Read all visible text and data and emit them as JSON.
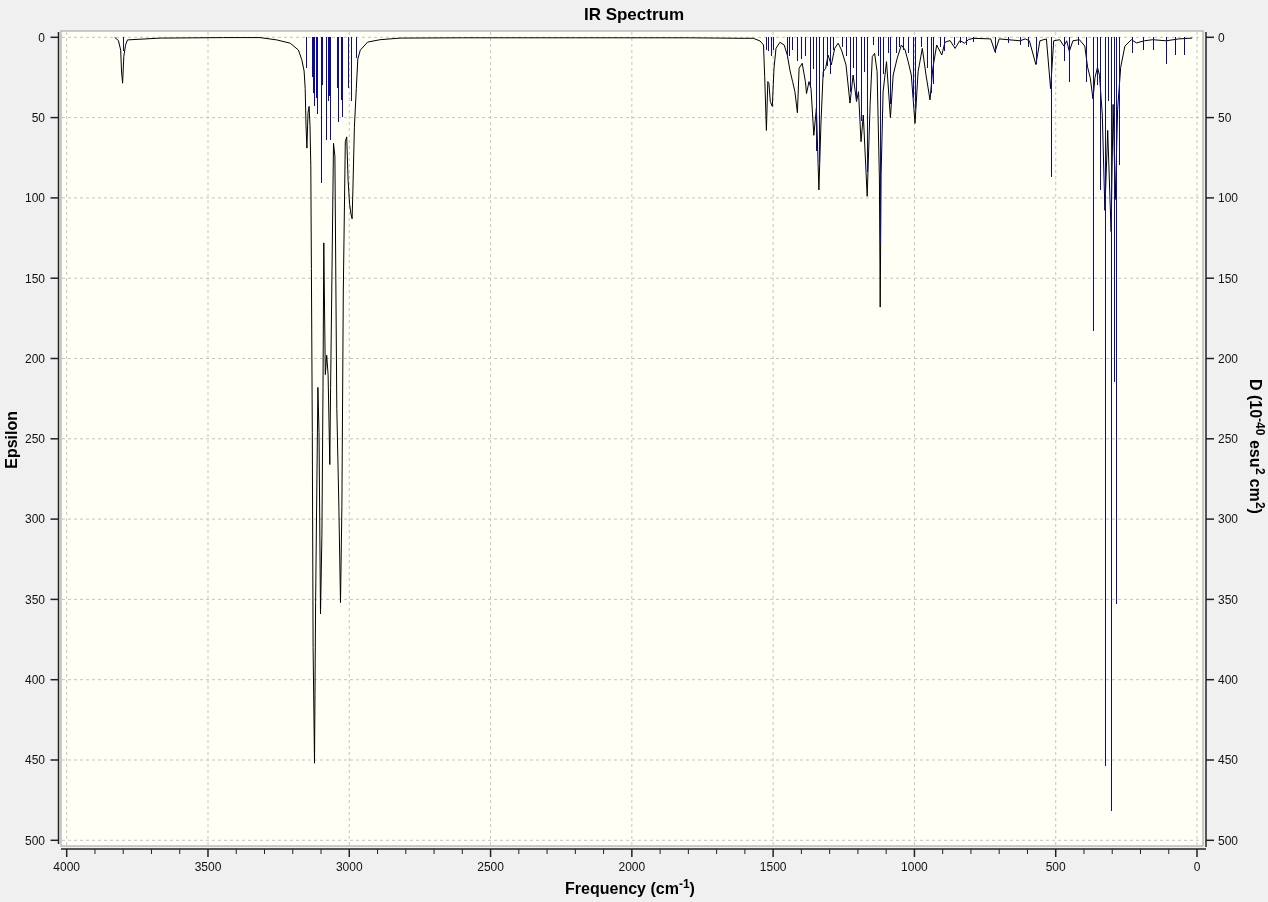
{
  "chart_data": {
    "type": "line",
    "title": "IR Spectrum",
    "xlabel": "Frequency (cm$^{-1}$)",
    "ylabel": "Epsilon",
    "y2label": "D (10$^{-40}$ esu$^{2}$ cm$^{2}$)",
    "xlim": [
      4000,
      0
    ],
    "ylim": [
      500,
      0
    ],
    "y2lim": [
      500,
      0
    ],
    "grid": true,
    "xticks": [
      4000,
      3500,
      3000,
      2500,
      2000,
      1500,
      1000,
      500,
      0
    ],
    "yticks": [
      0,
      50,
      100,
      150,
      200,
      250,
      300,
      350,
      400,
      450,
      500
    ],
    "y2ticks": [
      0,
      50,
      100,
      150,
      200,
      250,
      300,
      350,
      400,
      450,
      500
    ],
    "series": [
      {
        "color": "#000000",
        "x": [
          3830,
          3817,
          3809,
          3806,
          3802,
          3798,
          3792,
          3785,
          3669,
          3445,
          3316,
          3257,
          3209,
          3180,
          3168,
          3160,
          3156,
          3153,
          3150,
          3146,
          3142,
          3139,
          3136,
          3134,
          3131,
          3128,
          3123,
          3119,
          3111,
          3107,
          3102,
          3097,
          3093,
          3090,
          3085,
          3080,
          3075,
          3069,
          3066,
          3061,
          3056,
          3051,
          3044,
          3037,
          3031,
          3026,
          3021,
          3014,
          3009,
          3004,
          2999,
          2994,
          2990,
          2987,
          2982,
          2975,
          2970,
          2961,
          2935,
          2891,
          2820,
          2600,
          2200,
          1800,
          1617,
          1570,
          1546,
          1534,
          1530,
          1524,
          1519,
          1515,
          1510,
          1503,
          1497,
          1490,
          1476,
          1461,
          1450,
          1440,
          1431,
          1423,
          1414,
          1408,
          1397,
          1386,
          1382,
          1373,
          1366,
          1356,
          1347,
          1338,
          1331,
          1323,
          1314,
          1306,
          1294,
          1282,
          1270,
          1258,
          1242,
          1228,
          1217,
          1205,
          1198,
          1189,
          1181,
          1167,
          1157,
          1149,
          1141,
          1132,
          1124,
          1121,
          1118,
          1111,
          1099,
          1085,
          1075,
          1061,
          1046,
          1033,
          1022,
          1011,
          998,
          987,
          972,
          959,
          945,
          935,
          921,
          903,
          892,
          874,
          856,
          839,
          823,
          809,
          792,
          730,
          715,
          700,
          626,
          608,
          593,
          570,
          556,
          533,
          518,
          507,
          486,
          471,
          461,
          452,
          439,
          416,
          397,
          387,
          378,
          368,
          361,
          352,
          345,
          335,
          326,
          316,
          304,
          297,
          289,
          281,
          270,
          255,
          232,
          214,
          186,
          157,
          109,
          64,
          17
        ],
        "values": [
          0,
          2,
          8,
          21,
          28.6,
          12,
          4.9,
          1.6,
          0.5,
          0.2,
          0.2,
          1.6,
          3.7,
          7.9,
          14,
          21,
          32,
          55,
          69,
          47,
          43,
          55,
          80,
          144,
          246,
          380,
          452,
          352,
          218,
          246,
          359,
          310,
          218,
          128,
          210,
          198,
          210,
          266,
          218,
          145,
          66,
          74,
          231,
          290,
          352,
          292,
          158,
          65,
          62,
          89,
          104,
          110,
          113,
          95,
          56,
          32,
          13.5,
          8,
          3,
          1.5,
          0.5,
          0.3,
          0.3,
          0.3,
          0.6,
          0.6,
          2.3,
          4.8,
          24.5,
          58,
          27.6,
          28.7,
          40,
          43,
          19.3,
          6.9,
          3.1,
          4.8,
          11,
          21,
          27.6,
          33.8,
          47,
          19.3,
          16.2,
          27.6,
          35,
          27.6,
          31.8,
          61,
          44,
          95,
          54.6,
          21.4,
          19.3,
          11,
          17.2,
          6.9,
          3.7,
          7.9,
          17.2,
          41,
          23.5,
          40,
          33.9,
          65,
          48.4,
          99,
          42,
          12,
          10,
          21.4,
          87.6,
          168,
          85.7,
          33.9,
          15.2,
          50,
          23.5,
          13,
          4.8,
          7.9,
          15.2,
          23.5,
          53.6,
          21.4,
          6.9,
          23.5,
          39,
          19.3,
          4.8,
          11,
          3.1,
          2,
          6.9,
          2,
          3.7,
          1.5,
          0.6,
          1,
          9,
          1,
          2.2,
          1,
          2.2,
          17,
          2.2,
          1,
          32,
          2.2,
          1.5,
          5.5,
          2.2,
          8.8,
          2.2,
          1.5,
          5.5,
          18.7,
          25,
          38.4,
          25,
          18.7,
          23.7,
          48.4,
          107.8,
          58,
          121,
          41.8,
          101,
          45,
          18.7,
          5.5,
          1.5,
          3.5,
          2.2,
          1.5,
          2.2,
          1,
          0.5
        ]
      },
      {
        "type": "bar",
        "color": "#0a0aa0",
        "x": [
          3802,
          3152,
          3131,
          3127,
          3124,
          3119,
          3113,
          3101,
          3097,
          3083,
          3076,
          3070,
          3067,
          3044,
          3039,
          3031,
          3024,
          3003,
          2993,
          2975,
          1525,
          1517,
          1509,
          1502,
          1452,
          1445,
          1434,
          1417,
          1401,
          1387,
          1370,
          1358,
          1347,
          1338,
          1323,
          1309,
          1300,
          1288,
          1255,
          1243,
          1228,
          1217,
          1208,
          1190,
          1178,
          1169,
          1148,
          1128,
          1121,
          1111,
          1092,
          1085,
          1064,
          1055,
          1039,
          1022,
          1004,
          997,
          975,
          957,
          943,
          935,
          909,
          894,
          861,
          839,
          818,
          792,
          715,
          670,
          626,
          598,
          570,
          518,
          471,
          452,
          420,
          393,
          368,
          355,
          345,
          325,
          315,
          304,
          293,
          285,
          277,
          229,
          191,
          154,
          109,
          79,
          45
        ],
        "values": [
          9,
          19,
          25,
          35,
          43,
          38,
          48,
          91,
          30,
          64,
          40,
          37,
          64,
          32,
          53,
          39,
          50,
          32,
          40,
          13,
          8,
          9,
          12,
          8,
          13,
          12,
          8,
          15,
          14,
          12,
          32,
          20,
          71,
          78,
          25,
          18,
          23,
          8,
          6,
          12,
          34,
          19,
          40,
          52,
          22,
          84,
          5,
          12,
          129,
          23,
          10,
          42,
          10,
          6,
          8,
          10,
          38,
          45,
          6,
          19,
          35,
          29,
          6,
          9,
          5,
          4,
          5,
          3,
          10,
          4,
          5,
          6,
          17,
          87,
          15,
          28,
          5,
          28,
          183,
          30,
          95,
          454,
          40,
          482,
          215,
          353,
          80,
          10,
          8,
          8,
          17,
          11,
          11
        ]
      }
    ]
  }
}
